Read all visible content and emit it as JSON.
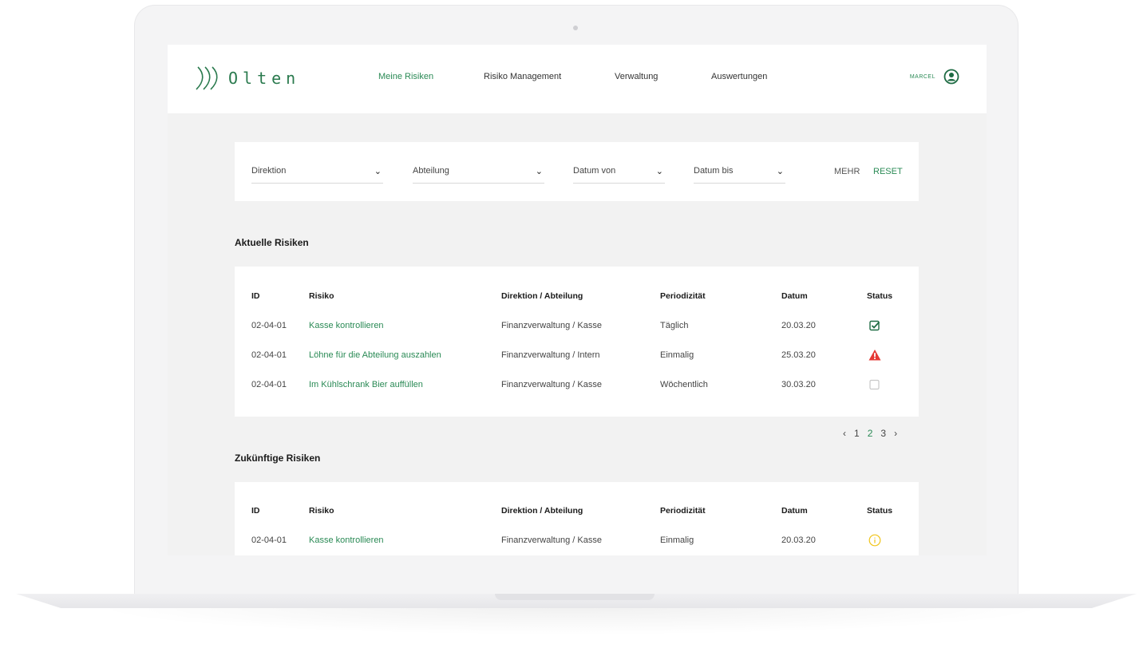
{
  "app": {
    "logo_text": "Olten",
    "user_name": "MARCEL"
  },
  "nav": [
    "Meine Risiken",
    "Risiko Management",
    "Verwaltung",
    "Auswertungen"
  ],
  "filters": {
    "direktion": "Direktion",
    "abteilung": "Abteilung",
    "datum_von": "Datum von",
    "datum_bis": "Datum bis",
    "mehr": "MEHR",
    "reset": "RESET"
  },
  "columns": [
    "ID",
    "Risiko",
    "Direktion / Abteilung",
    "Periodizität",
    "Datum",
    "Status"
  ],
  "current": {
    "title": "Aktuelle Risiken",
    "rows": [
      {
        "id": "02-04-01",
        "risk": "Kasse kontrollieren",
        "dept": "Finanzverwaltung / Kasse",
        "period": "Täglich",
        "date": "20.03.20",
        "status": "checked-checkbox-icon"
      },
      {
        "id": "02-04-01",
        "risk": "Löhne für die Abteilung auszahlen",
        "dept": "Finanzverwaltung / Intern",
        "period": "Einmalig",
        "date": "25.03.20",
        "status": "warning-triangle-icon"
      },
      {
        "id": "02-04-01",
        "risk": "Im Kühlschrank Bier auffüllen",
        "dept": "Finanzverwaltung / Kasse",
        "period": "Wöchentlich",
        "date": "30.03.20",
        "status": "empty-checkbox-icon"
      }
    ]
  },
  "pagination": {
    "prev": "‹",
    "pages": [
      "1",
      "2",
      "3"
    ],
    "current": "2",
    "next": "›"
  },
  "future": {
    "title": "Zukünftige Risiken",
    "rows": [
      {
        "id": "02-04-01",
        "risk": "Kasse kontrollieren",
        "dept": "Finanzverwaltung / Kasse",
        "period": "Einmalig",
        "date": "20.03.20",
        "status": "info-circle-icon"
      }
    ]
  },
  "colors": {
    "accent": "#2a8a55",
    "warning": "#e53935",
    "info": "#f0c419",
    "background": "#f2f2f2"
  }
}
